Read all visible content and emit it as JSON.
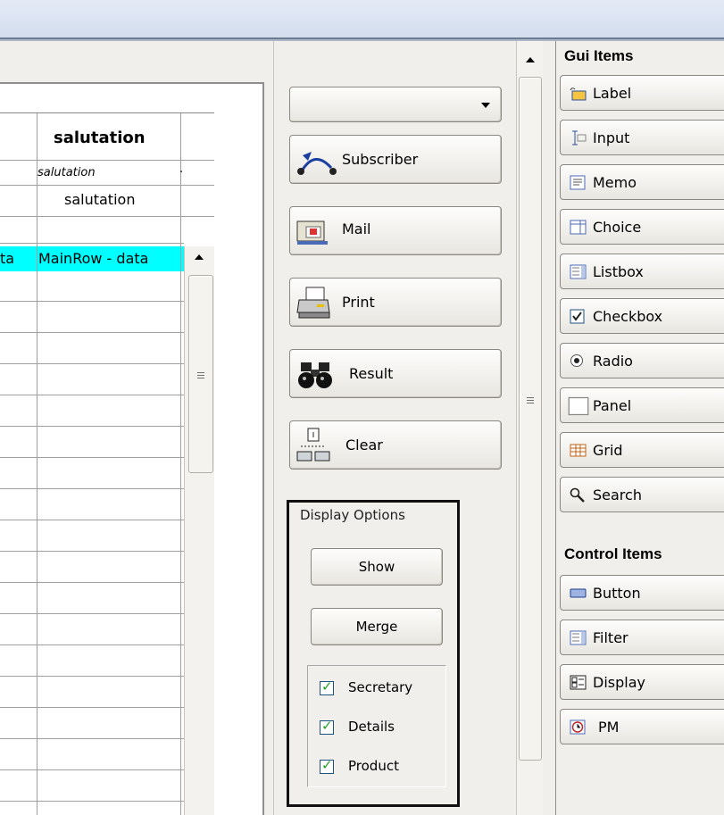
{
  "grid": {
    "column_header": "salutation",
    "subheader_italic": "salutation",
    "subheader_value": "salutation",
    "highlight_cells": [
      "ta",
      "MainRow - data"
    ]
  },
  "middle": {
    "dropdown_value": "",
    "buttons": [
      {
        "label": "Subscriber",
        "icon": "subscriber-icon"
      },
      {
        "label": "Mail",
        "icon": "mail-icon"
      },
      {
        "label": "Print",
        "icon": "print-icon"
      },
      {
        "label": "Result",
        "icon": "binoculars-icon"
      },
      {
        "label": "Clear",
        "icon": "clear-icon"
      }
    ],
    "display_options": {
      "legend": "Display Options",
      "show_label": "Show",
      "merge_label": "Merge",
      "checkboxes": [
        {
          "label": "Secretary",
          "checked": true
        },
        {
          "label": "Details",
          "checked": true
        },
        {
          "label": "Product",
          "checked": true
        }
      ]
    }
  },
  "palette": {
    "gui_title": "Gui Items",
    "gui_items": [
      {
        "label": "Label",
        "icon": "label-icon"
      },
      {
        "label": "Input",
        "icon": "input-icon"
      },
      {
        "label": "Memo",
        "icon": "memo-icon"
      },
      {
        "label": "Choice",
        "icon": "choice-icon"
      },
      {
        "label": "Listbox",
        "icon": "listbox-icon"
      },
      {
        "label": "Checkbox",
        "icon": "checkbox-icon"
      },
      {
        "label": "Radio",
        "icon": "radio-icon"
      },
      {
        "label": "Panel",
        "icon": "panel-icon"
      },
      {
        "label": "Grid",
        "icon": "grid-icon"
      },
      {
        "label": "Search",
        "icon": "search-icon"
      }
    ],
    "control_title": "Control Items",
    "control_items": [
      {
        "label": "Button",
        "icon": "button-icon"
      },
      {
        "label": "Filter",
        "icon": "filter-icon"
      },
      {
        "label": "Display",
        "icon": "display-icon"
      },
      {
        "label": "PM",
        "icon": "clock-icon"
      }
    ]
  },
  "colors": {
    "row_highlight": "#00ffff",
    "check": "#21a121"
  }
}
